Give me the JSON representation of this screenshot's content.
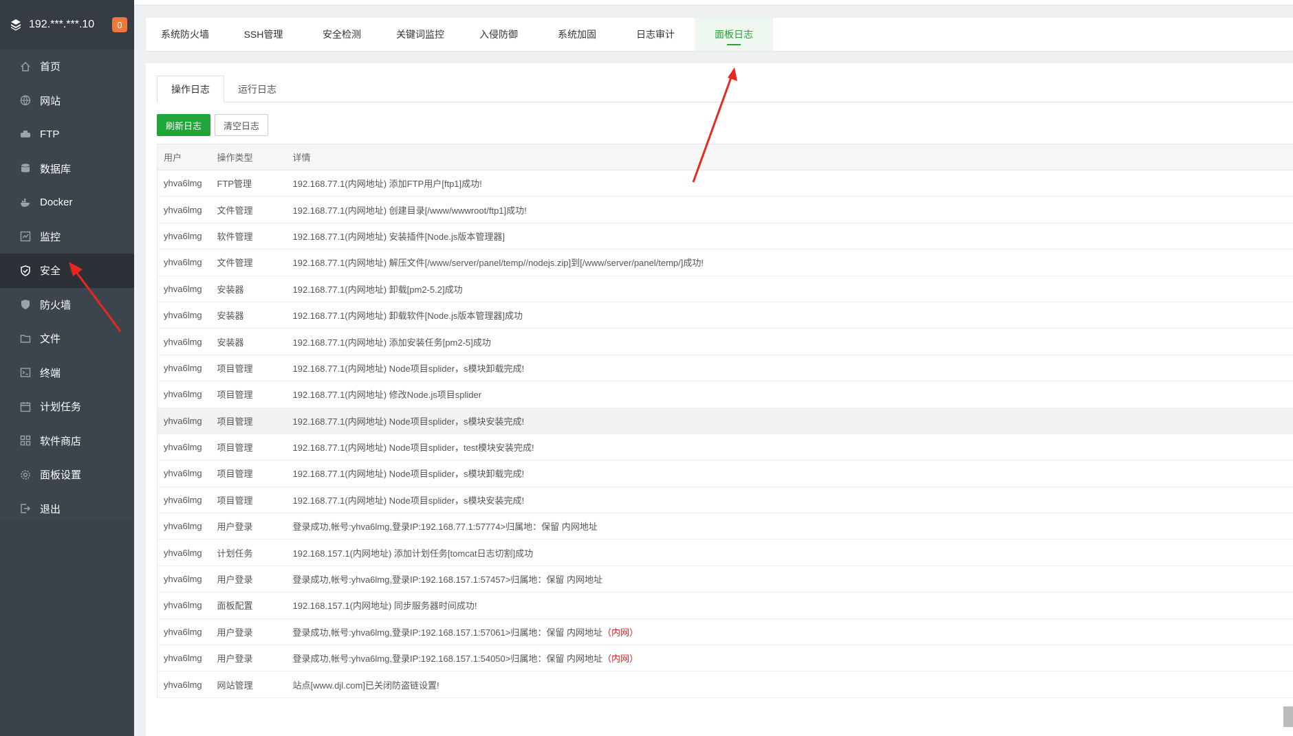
{
  "sidebar": {
    "server_ip": "192.***.***.10",
    "badge_count": "0",
    "items": [
      {
        "label": "首页",
        "icon": "home-icon"
      },
      {
        "label": "网站",
        "icon": "globe-icon"
      },
      {
        "label": "FTP",
        "icon": "ftp-icon"
      },
      {
        "label": "数据库",
        "icon": "database-icon"
      },
      {
        "label": "Docker",
        "icon": "docker-icon"
      },
      {
        "label": "监控",
        "icon": "monitor-icon"
      },
      {
        "label": "安全",
        "icon": "shield-check-icon"
      },
      {
        "label": "防火墙",
        "icon": "firewall-shield-icon"
      },
      {
        "label": "文件",
        "icon": "folder-icon"
      },
      {
        "label": "终端",
        "icon": "terminal-icon"
      },
      {
        "label": "计划任务",
        "icon": "calendar-icon"
      },
      {
        "label": "软件商店",
        "icon": "grid-apps-icon"
      },
      {
        "label": "面板设置",
        "icon": "gear-icon"
      },
      {
        "label": "退出",
        "icon": "logout-icon"
      }
    ],
    "active_index": 6
  },
  "tabs": [
    "系统防火墙",
    "SSH管理",
    "安全检测",
    "关键词监控",
    "入侵防御",
    "系统加固",
    "日志审计",
    "面板日志"
  ],
  "active_tab": "面板日志",
  "subtabs": [
    "操作日志",
    "运行日志"
  ],
  "active_subtab": "操作日志",
  "buttons": {
    "refresh": "刷新日志",
    "clear": "清空日志"
  },
  "table": {
    "headers": [
      "用户",
      "操作类型",
      "详情"
    ],
    "rows": [
      {
        "user": "yhva6lmg",
        "type": "FTP管理",
        "detail": "192.168.77.1(内网地址) 添加FTP用户[ftp1]成功!",
        "tag": ""
      },
      {
        "user": "yhva6lmg",
        "type": "文件管理",
        "detail": "192.168.77.1(内网地址) 创建目录[/www/wwwroot/ftp1]成功!",
        "tag": ""
      },
      {
        "user": "yhva6lmg",
        "type": "软件管理",
        "detail": "192.168.77.1(内网地址) 安装插件[Node.js版本管理器]",
        "tag": ""
      },
      {
        "user": "yhva6lmg",
        "type": "文件管理",
        "detail": "192.168.77.1(内网地址) 解压文件[/www/server/panel/temp//nodejs.zip]到[/www/server/panel/temp/]成功!",
        "tag": ""
      },
      {
        "user": "yhva6lmg",
        "type": "安装器",
        "detail": "192.168.77.1(内网地址) 卸载[pm2-5.2]成功",
        "tag": ""
      },
      {
        "user": "yhva6lmg",
        "type": "安装器",
        "detail": "192.168.77.1(内网地址) 卸载软件[Node.js版本管理器]成功",
        "tag": ""
      },
      {
        "user": "yhva6lmg",
        "type": "安装器",
        "detail": "192.168.77.1(内网地址) 添加安装任务[pm2-5]成功",
        "tag": ""
      },
      {
        "user": "yhva6lmg",
        "type": "项目管理",
        "detail": "192.168.77.1(内网地址) Node项目splider，s模块卸载完成!",
        "tag": ""
      },
      {
        "user": "yhva6lmg",
        "type": "项目管理",
        "detail": "192.168.77.1(内网地址) 修改Node.js项目splider",
        "tag": ""
      },
      {
        "user": "yhva6lmg",
        "type": "项目管理",
        "detail": "192.168.77.1(内网地址) Node项目splider，s模块安装完成!",
        "tag": ""
      },
      {
        "user": "yhva6lmg",
        "type": "项目管理",
        "detail": "192.168.77.1(内网地址) Node项目splider，test模块安装完成!",
        "tag": ""
      },
      {
        "user": "yhva6lmg",
        "type": "项目管理",
        "detail": "192.168.77.1(内网地址) Node项目splider，s模块卸载完成!",
        "tag": ""
      },
      {
        "user": "yhva6lmg",
        "type": "项目管理",
        "detail": "192.168.77.1(内网地址) Node项目splider，s模块安装完成!",
        "tag": ""
      },
      {
        "user": "yhva6lmg",
        "type": "用户登录",
        "detail": "登录成功,帐号:yhva6lmg,登录IP:192.168.77.1:57774>归属地：保留 内网地址",
        "tag": ""
      },
      {
        "user": "yhva6lmg",
        "type": "计划任务",
        "detail": "192.168.157.1(内网地址) 添加计划任务[tomcat日志切割]成功",
        "tag": ""
      },
      {
        "user": "yhva6lmg",
        "type": "用户登录",
        "detail": "登录成功,帐号:yhva6lmg,登录IP:192.168.157.1:57457>归属地：保留 内网地址",
        "tag": ""
      },
      {
        "user": "yhva6lmg",
        "type": "面板配置",
        "detail": "192.168.157.1(内网地址) 同步服务器时间成功!",
        "tag": ""
      },
      {
        "user": "yhva6lmg",
        "type": "用户登录",
        "detail": "登录成功,帐号:yhva6lmg,登录IP:192.168.157.1:57061>归属地：保留 内网地址",
        "tag": "（内网）"
      },
      {
        "user": "yhva6lmg",
        "type": "用户登录",
        "detail": "登录成功,帐号:yhva6lmg,登录IP:192.168.157.1:54050>归属地：保留 内网地址",
        "tag": "（内网）"
      },
      {
        "user": "yhva6lmg",
        "type": "网站管理",
        "detail": "站点[www.djl.com]已关闭防盗链设置!",
        "tag": ""
      }
    ],
    "highlighted_row": 9
  },
  "colors": {
    "accent": "#20a53a",
    "sidebar_bg": "#3c444d",
    "annotation": "#e8281e"
  }
}
